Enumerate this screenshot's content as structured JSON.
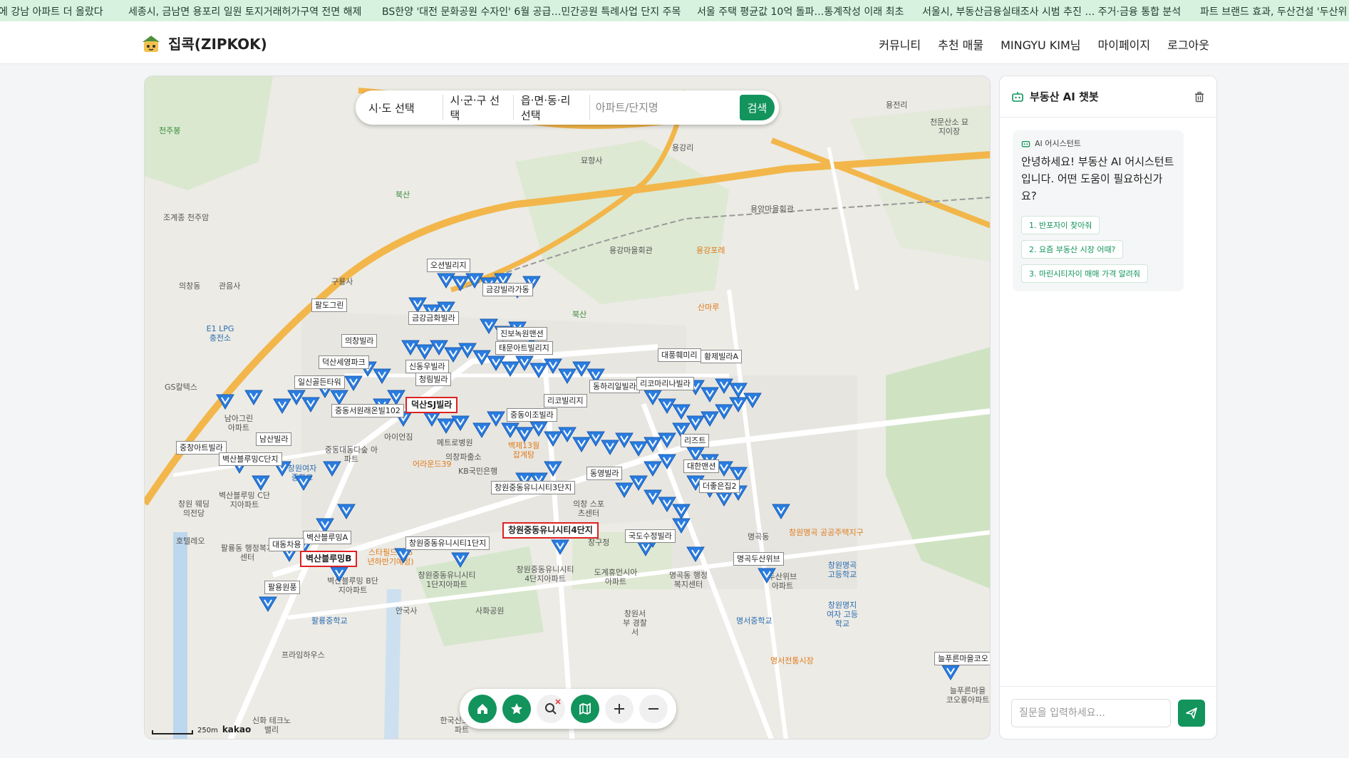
{
  "ticker": [
    "에 강남 아파트 더 올랐다",
    "세종시, 금남면 용포리 일원 토지거래허가구역 전면 해제",
    "BS한양 '대전 문화공원 수자인' 6월 공급…민간공원 특례사업 단지 주목",
    "서울 주택 평균값 10억 돌파…통계작성 이래 최초",
    "서울시, 부동산금융실태조사 시범 추진 … 주거·금융 통합 분석",
    "파트 브랜드 효과, 두산건설 '두산위"
  ],
  "brand": {
    "name": "집콕(ZIPKOK)"
  },
  "nav": {
    "community": "커뮤니티",
    "recommended": "추천 매물",
    "user": "MINGYU KIM님",
    "mypage": "마이페이지",
    "logout": "로그아웃"
  },
  "search": {
    "sido": "시·도 선택",
    "sigungu": "시·군·구 선택",
    "dong": "읍·면·동·리 선택",
    "placeholder": "아파트/단지명",
    "button": "검색"
  },
  "map": {
    "scale": "250m",
    "provider": "kakao",
    "highlighted_labels": [
      "덕산SJ빌라",
      "창원중동유니시티4단지",
      "벽산블루밍B"
    ],
    "labels": [
      "오션빌리지",
      "금강빌라가동",
      "팔도그린",
      "금강금화빌라",
      "의창빌라",
      "덕산세영파크",
      "일신골든타워",
      "진보녹원맨션",
      "태문아트빌리지",
      "신동우빌라",
      "청림빌라",
      "중동서원래온빌102",
      "남산빌라",
      "중창아트빌라",
      "벽산블루밍C단지",
      "중동이조빌라",
      "리코빌리지",
      "동하리일빌라",
      "리코마리나빌라",
      "대풍훼미리",
      "황제빌라A",
      "동영빌라",
      "리즈트",
      "대한맨션",
      "더좋은집2",
      "창원중동유니시티3단지",
      "창원중동유니시티1단지",
      "국도수정빌라",
      "명곡두산위브",
      "벽산블루밍A",
      "대동차용",
      "팔용원풍",
      "늘푸른마을코오"
    ],
    "places": [
      "천주봉",
      "조계종 천주암",
      "의창동",
      "관음사",
      "구룡사",
      "E1 LPG 충전소",
      "GS칼텍스",
      "남아그린 아파트",
      "묘향사",
      "북산",
      "용강리",
      "용암마을회관",
      "용강마을회관",
      "용강포레",
      "산마루",
      "북산",
      "용전리",
      "천문산소 묘지이장",
      "아이언짐",
      "메트로병원",
      "의창파출소",
      "KB국민은행",
      "중동대동다숲 아파트",
      "창원여자 중학교",
      "벽산블루밍 C단지아파트",
      "창원 웨딩의전당",
      "호텔레오",
      "팔룡동 행정복지센터",
      "벽산블루밍 B단지아파트",
      "팔룡중학교",
      "프라임하우스",
      "안국사",
      "사화공원",
      "창원중동유니시티 1단지아파트",
      "창원중동유니시티 4단지아파트",
      "도계휴먼시아 아파트",
      "명곡동 행정복지센터",
      "창원서부 경찰서",
      "명곡동",
      "창원명곡 고등학교",
      "창원명지여자 고등학교",
      "명서중학교",
      "명서전통시장",
      "두산위브 아파트",
      "늘푸른마을 코오롱아파트",
      "한국신도 5아파트",
      "신화 테크노밸리",
      "백제13월 잡계탕",
      "창구청",
      "의창 스포츠센터",
      "창원명곡 공공주택지구",
      "어라운드39",
      "스타필드 (16년하반기예정)"
    ]
  },
  "chat": {
    "title": "부동산 AI 챗봇",
    "sender": "AI 어시스턴트",
    "greeting": "안녕하세요! 부동산 AI 어시스턴트입니다. 어떤 도움이 필요하신가요?",
    "suggestions": [
      "1. 반포자이 찾아줘",
      "2. 요즘 부동산 시장 어때?",
      "3. 마린시티자이 매매 가격 알려줘"
    ],
    "input_placeholder": "질문을 입력하세요..."
  },
  "colors": {
    "accent": "#12945c",
    "pin": "#2a7de1",
    "highlight_border": "#d22222",
    "ticker_bg": "#d7f3e0"
  }
}
